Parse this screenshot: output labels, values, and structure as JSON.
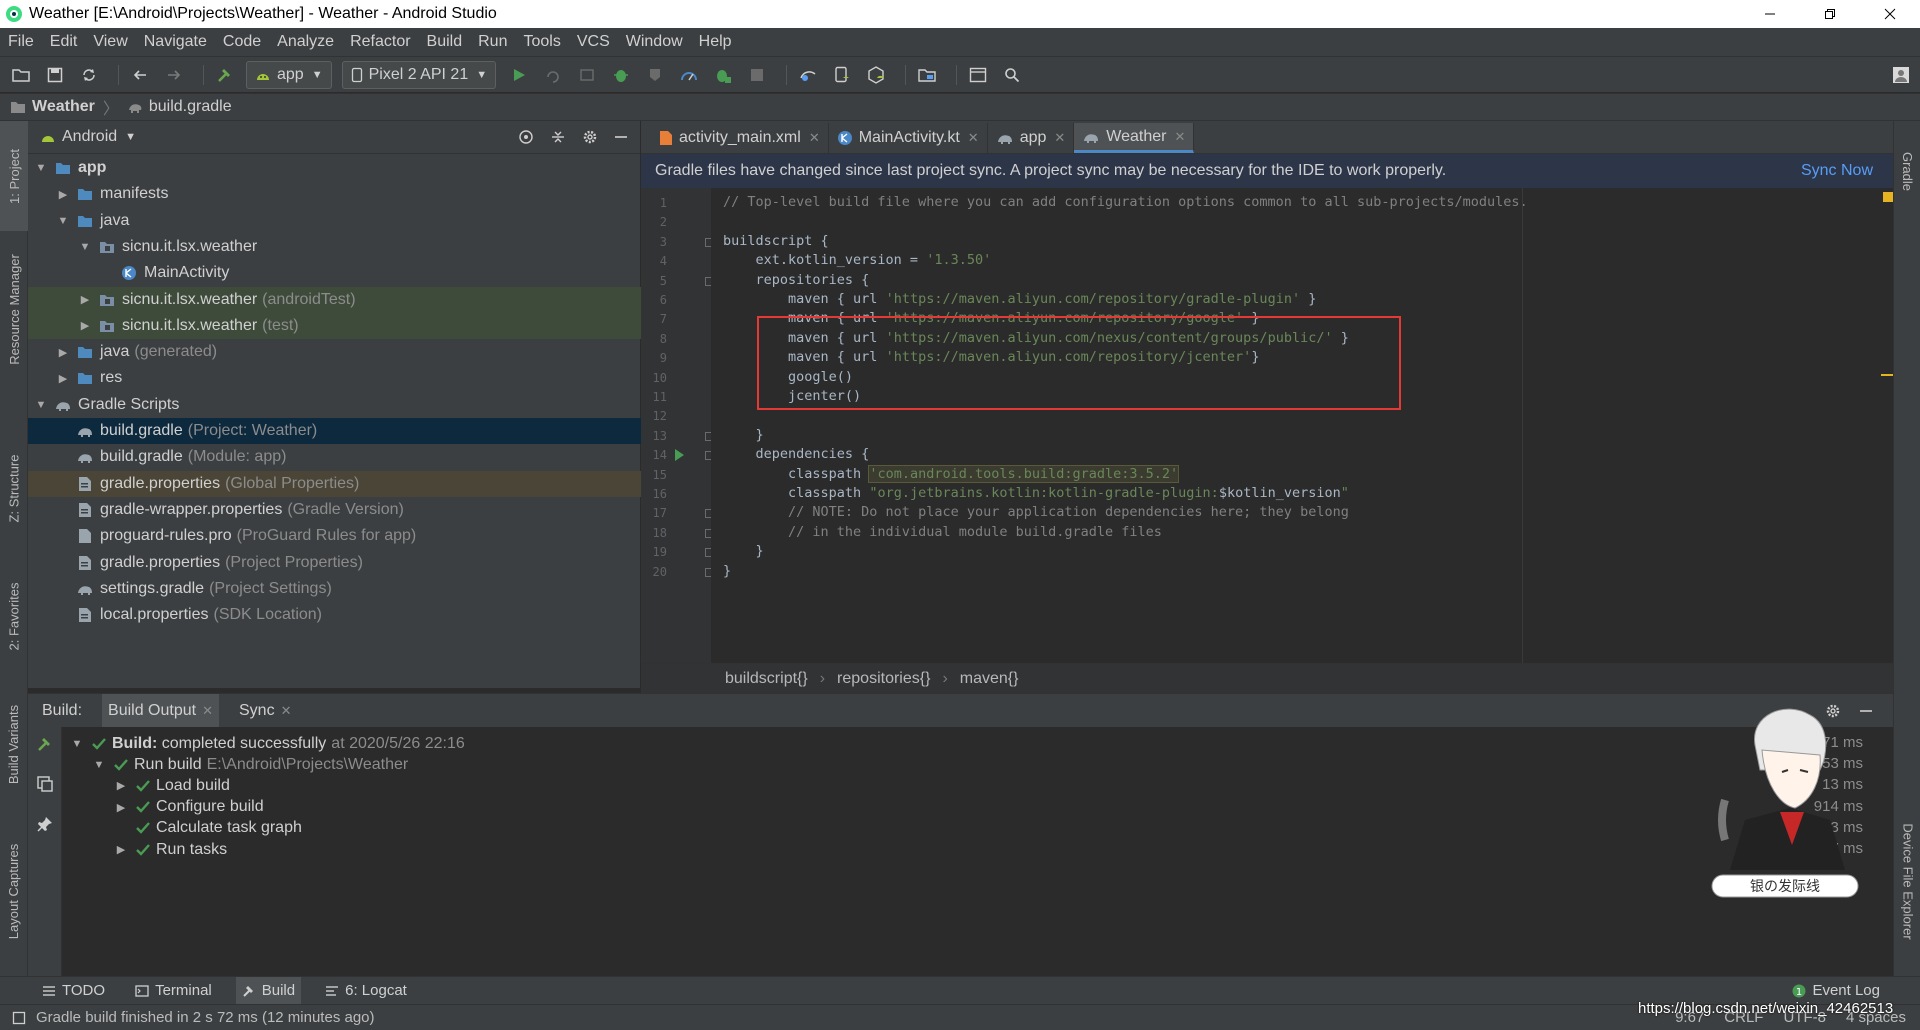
{
  "window": {
    "title": "Weather [E:\\Android\\Projects\\Weather] - Weather - Android Studio"
  },
  "menu": [
    "File",
    "Edit",
    "View",
    "Navigate",
    "Code",
    "Analyze",
    "Refactor",
    "Build",
    "Run",
    "Tools",
    "VCS",
    "Window",
    "Help"
  ],
  "toolbar": {
    "config": "app",
    "device": "Pixel 2 API 21"
  },
  "breadcrumb": {
    "project": "Weather",
    "file": "build.gradle"
  },
  "left_strip": {
    "project": "1: Project",
    "resource_manager": "Resource Manager",
    "structure": "Z: Structure",
    "favorites": "2: Favorites",
    "build_variants": "Build Variants",
    "layout_captures": "Layout Captures"
  },
  "right_strip": {
    "gradle": "Gradle",
    "device_file_explorer": "Device File Explorer"
  },
  "project_panel": {
    "view": "Android",
    "tree": [
      {
        "label": "app",
        "muted": "",
        "depth": 0,
        "arrow": "▼",
        "icon": "module-folder-icon",
        "bold": true
      },
      {
        "label": "manifests",
        "muted": "",
        "depth": 1,
        "arrow": "▶",
        "icon": "folder-icon"
      },
      {
        "label": "java",
        "muted": "",
        "depth": 1,
        "arrow": "▼",
        "icon": "folder-icon"
      },
      {
        "label": "sicnu.it.lsx.weather",
        "muted": "",
        "depth": 2,
        "arrow": "▼",
        "icon": "package-icon"
      },
      {
        "label": "MainActivity",
        "muted": "",
        "depth": 3,
        "arrow": "",
        "icon": "kotlin-class-icon"
      },
      {
        "label": "sicnu.it.lsx.weather",
        "muted": "(androidTest)",
        "depth": 2,
        "arrow": "▶",
        "icon": "package-icon",
        "highlight": "test"
      },
      {
        "label": "sicnu.it.lsx.weather",
        "muted": "(test)",
        "depth": 2,
        "arrow": "▶",
        "icon": "package-icon",
        "highlight": "test"
      },
      {
        "label": "java",
        "muted": "(generated)",
        "depth": 1,
        "arrow": "▶",
        "icon": "folder-generated-icon"
      },
      {
        "label": "res",
        "muted": "",
        "depth": 1,
        "arrow": "▶",
        "icon": "folder-res-icon"
      },
      {
        "label": "Gradle Scripts",
        "muted": "",
        "depth": 0,
        "arrow": "▼",
        "icon": "gradle-icon"
      },
      {
        "label": "build.gradle",
        "muted": "(Project: Weather)",
        "depth": 1,
        "arrow": "",
        "icon": "gradle-elephant-icon",
        "highlight": "selected"
      },
      {
        "label": "build.gradle",
        "muted": "(Module: app)",
        "depth": 1,
        "arrow": "",
        "icon": "gradle-elephant-icon"
      },
      {
        "label": "gradle.properties",
        "muted": "(Global Properties)",
        "depth": 1,
        "arrow": "",
        "icon": "properties-file-icon",
        "highlight": "global"
      },
      {
        "label": "gradle-wrapper.properties",
        "muted": "(Gradle Version)",
        "depth": 1,
        "arrow": "",
        "icon": "properties-file-icon"
      },
      {
        "label": "proguard-rules.pro",
        "muted": "(ProGuard Rules for app)",
        "depth": 1,
        "arrow": "",
        "icon": "text-file-icon"
      },
      {
        "label": "gradle.properties",
        "muted": "(Project Properties)",
        "depth": 1,
        "arrow": "",
        "icon": "properties-file-icon"
      },
      {
        "label": "settings.gradle",
        "muted": "(Project Settings)",
        "depth": 1,
        "arrow": "",
        "icon": "gradle-elephant-icon"
      },
      {
        "label": "local.properties",
        "muted": "(SDK Location)",
        "depth": 1,
        "arrow": "",
        "icon": "properties-file-icon"
      }
    ]
  },
  "editor": {
    "tabs": [
      {
        "label": "activity_main.xml",
        "icon": "xml-file-icon",
        "active": false
      },
      {
        "label": "MainActivity.kt",
        "icon": "kotlin-class-icon",
        "active": false
      },
      {
        "label": "app",
        "icon": "gradle-elephant-icon",
        "active": false
      },
      {
        "label": "Weather",
        "icon": "gradle-elephant-icon",
        "active": true
      }
    ],
    "banner": {
      "message": "Gradle files have changed since last project sync. A project sync may be necessary for the IDE to work properly.",
      "action": "Sync Now"
    },
    "lines": [
      {
        "n": "1",
        "parts": [
          {
            "t": "// Top-level build file where you can add configuration options common to all sub-projects/modules.",
            "c": "cmt"
          }
        ]
      },
      {
        "n": "2",
        "parts": []
      },
      {
        "n": "3",
        "parts": [
          {
            "t": "buildscript {",
            "c": "kw"
          }
        ]
      },
      {
        "n": "4",
        "parts": [
          {
            "t": "    ext.kotlin_version = ",
            "c": "kw"
          },
          {
            "t": "'1.3.50'",
            "c": "str"
          }
        ]
      },
      {
        "n": "5",
        "parts": [
          {
            "t": "    repositories {",
            "c": "kw"
          }
        ]
      },
      {
        "n": "6",
        "parts": [
          {
            "t": "        maven { url ",
            "c": "kw"
          },
          {
            "t": "'https://maven.aliyun.com/repository/gradle-plugin'",
            "c": "str"
          },
          {
            "t": " }",
            "c": "kw"
          }
        ]
      },
      {
        "n": "7",
        "parts": [
          {
            "t": "        maven { url ",
            "c": "kw"
          },
          {
            "t": "'https://maven.aliyun.com/repository/google'",
            "c": "str"
          },
          {
            "t": " }",
            "c": "kw"
          }
        ]
      },
      {
        "n": "8",
        "parts": [
          {
            "t": "        maven { url ",
            "c": "kw"
          },
          {
            "t": "'https://maven.aliyun.com/nexus/content/groups/public/'",
            "c": "str"
          },
          {
            "t": " }",
            "c": "kw"
          }
        ]
      },
      {
        "n": "9",
        "parts": [
          {
            "t": "        maven { url ",
            "c": "kw"
          },
          {
            "t": "'https://maven.aliyun.com/repository/jcenter'",
            "c": "str"
          },
          {
            "t": "}",
            "c": "kw"
          }
        ]
      },
      {
        "n": "10",
        "parts": [
          {
            "t": "        google()",
            "c": "kw"
          }
        ]
      },
      {
        "n": "11",
        "parts": [
          {
            "t": "        jcenter()",
            "c": "kw"
          }
        ]
      },
      {
        "n": "12",
        "parts": []
      },
      {
        "n": "13",
        "parts": [
          {
            "t": "    }",
            "c": "kw"
          }
        ]
      },
      {
        "n": "14",
        "parts": [
          {
            "t": "    dependencies {",
            "c": "kw"
          }
        ]
      },
      {
        "n": "15",
        "parts": [
          {
            "t": "        classpath ",
            "c": "kw"
          },
          {
            "t": "'com.android.tools.build:gradle:3.5.2'",
            "c": "strhl"
          }
        ]
      },
      {
        "n": "16",
        "parts": [
          {
            "t": "        classpath ",
            "c": "kw"
          },
          {
            "t": "\"org.jetbrains.kotlin:kotlin-gradle-plugin:",
            "c": "str"
          },
          {
            "t": "$kotlin_version",
            "c": "kw"
          },
          {
            "t": "\"",
            "c": "str"
          }
        ]
      },
      {
        "n": "17",
        "parts": [
          {
            "t": "        // NOTE: Do not place your application dependencies here; they belong",
            "c": "cmt"
          }
        ]
      },
      {
        "n": "18",
        "parts": [
          {
            "t": "        // in the individual module build.gradle files",
            "c": "cmt"
          }
        ]
      },
      {
        "n": "19",
        "parts": [
          {
            "t": "    }",
            "c": "kw"
          }
        ]
      },
      {
        "n": "20",
        "parts": [
          {
            "t": "}",
            "c": "kw"
          }
        ]
      }
    ],
    "crumbs": [
      "buildscript{}",
      "repositories{}",
      "maven{}"
    ]
  },
  "build": {
    "label": "Build:",
    "tabs": [
      "Build Output",
      "Sync"
    ],
    "tree": [
      {
        "arrow": "▼",
        "depth": 0,
        "bold": "Build:",
        "text": " completed successfully",
        "muted": "at 2020/5/26 22:16",
        "time": "2 s 71 ms"
      },
      {
        "arrow": "▼",
        "depth": 1,
        "bold": "",
        "text": "Run build",
        "muted": "E:\\Android\\Projects\\Weather",
        "time": "1 s 953 ms"
      },
      {
        "arrow": "▶",
        "depth": 2,
        "bold": "",
        "text": "Load build",
        "muted": "",
        "time": "13 ms"
      },
      {
        "arrow": "▶",
        "depth": 2,
        "bold": "",
        "text": "Configure build",
        "muted": "",
        "time": "914 ms"
      },
      {
        "arrow": "",
        "depth": 2,
        "bold": "",
        "text": "Calculate task graph",
        "muted": "",
        "time": "23 ms"
      },
      {
        "arrow": "▶",
        "depth": 2,
        "bold": "",
        "text": "Run tasks",
        "muted": "",
        "time": "97 ms"
      }
    ]
  },
  "bottom_tabs": [
    "TODO",
    "Terminal",
    "Build",
    "6: Logcat"
  ],
  "event_log": "Event Log",
  "status": {
    "message": "Gradle build finished in 2 s 72 ms (12 minutes ago)",
    "position": "9:67",
    "line_sep": "CRLF",
    "encoding": "UTF-8",
    "indent": "4 spaces"
  },
  "watermark": {
    "url": "https://blog.csdn.net/weixin_42462513",
    "mascot_caption": "银の发际线"
  },
  "colors": {
    "accent": "#589df6",
    "selection": "#0d293e",
    "success": "#499c54",
    "highlight_box": "#e53935"
  }
}
